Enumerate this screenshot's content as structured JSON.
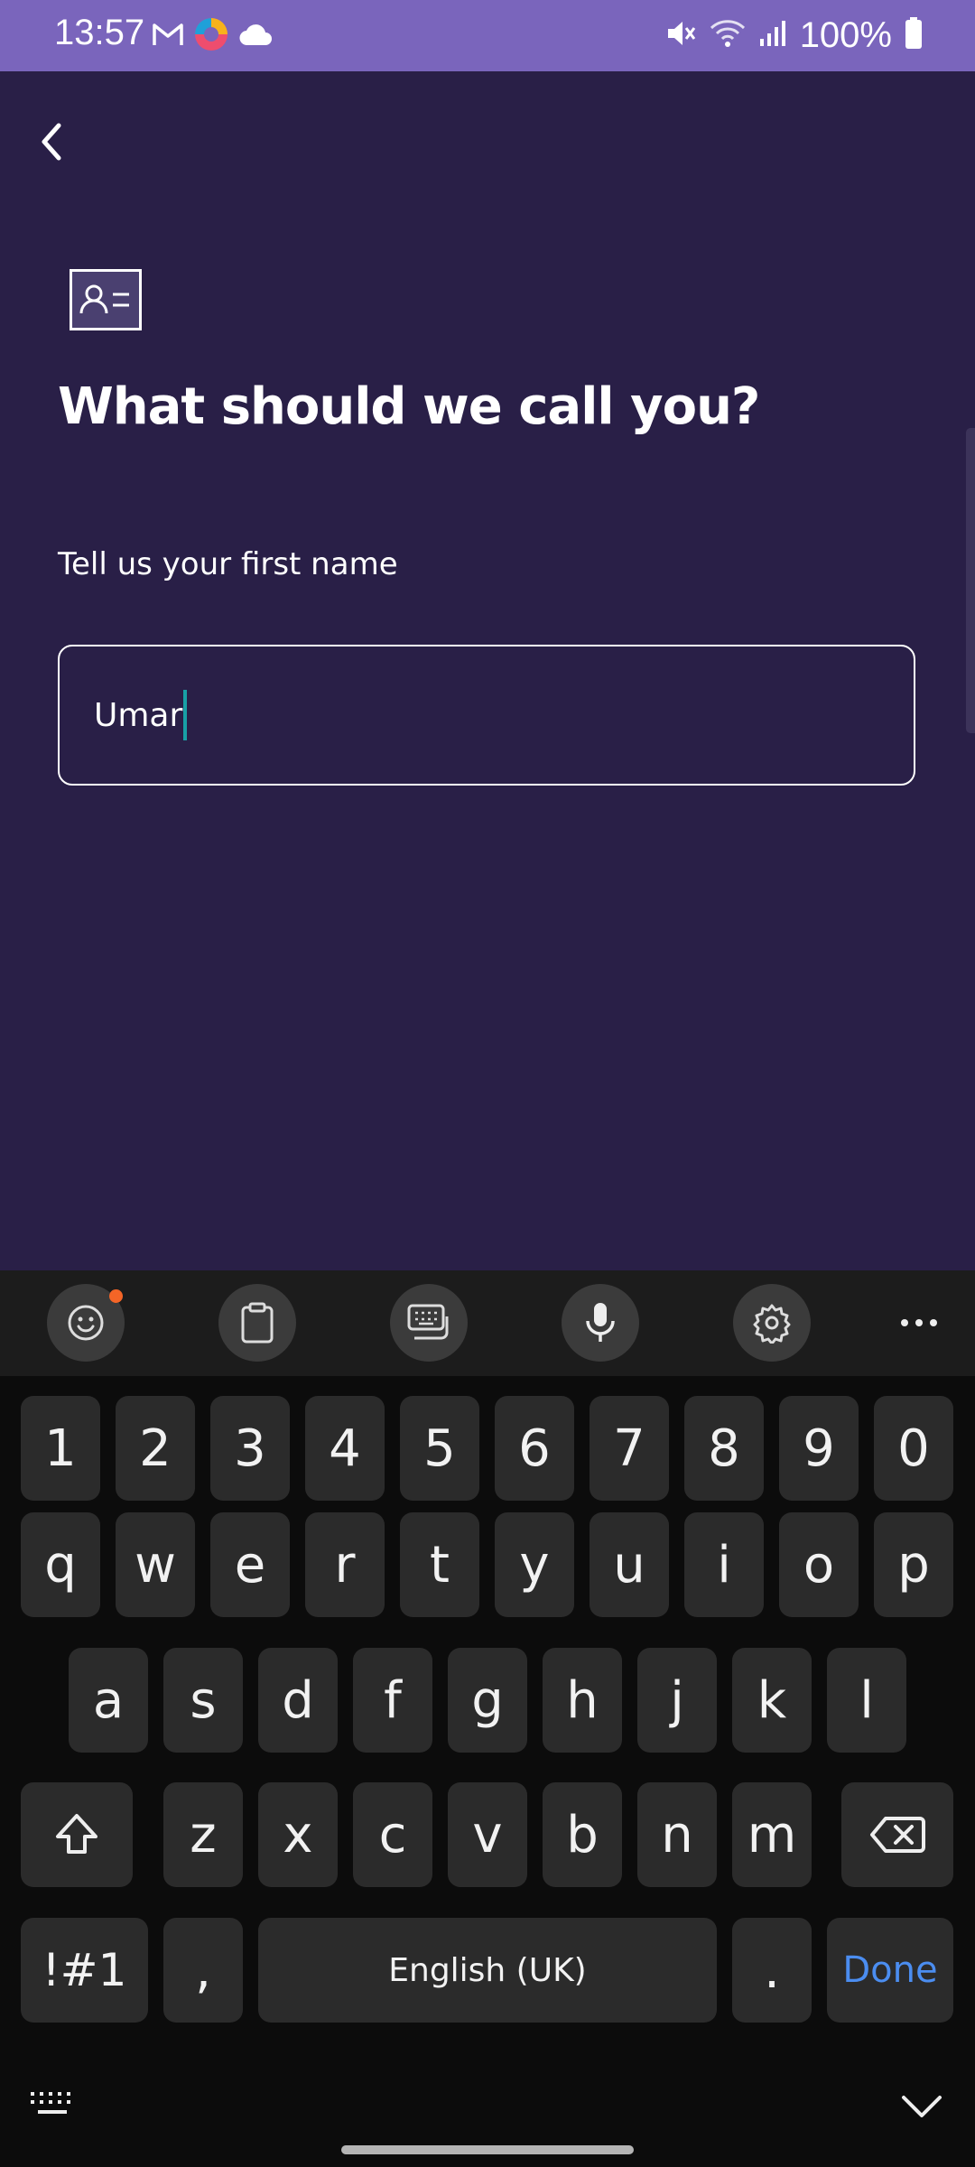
{
  "status_bar": {
    "time": "13:57",
    "battery": "100%",
    "icons_left": [
      "gmail-icon",
      "browser-icon",
      "cloud-icon"
    ],
    "icons_right": [
      "mute-icon",
      "wifi-icon",
      "signal-icon",
      "battery-icon"
    ]
  },
  "screen": {
    "title": "What should we call you?",
    "subtitle": "Tell us your first name",
    "name_input": {
      "value": "Umar"
    }
  },
  "keyboard": {
    "toolbar": [
      "emoji-icon",
      "clipboard-icon",
      "keyboard-mode-icon",
      "mic-icon",
      "settings-icon",
      "more-icon"
    ],
    "row_numbers": [
      "1",
      "2",
      "3",
      "4",
      "5",
      "6",
      "7",
      "8",
      "9",
      "0"
    ],
    "row1": [
      "q",
      "w",
      "e",
      "r",
      "t",
      "y",
      "u",
      "i",
      "o",
      "p"
    ],
    "row2": [
      "a",
      "s",
      "d",
      "f",
      "g",
      "h",
      "j",
      "k",
      "l"
    ],
    "row3": [
      "z",
      "x",
      "c",
      "v",
      "b",
      "n",
      "m"
    ],
    "symbols_label": "!#1",
    "comma_label": ",",
    "space_label": "English (UK)",
    "period_label": ".",
    "done_label": "Done"
  },
  "colors": {
    "status_bar": "#7a65bc",
    "background": "#291f47",
    "caret": "#18a0a6",
    "done": "#4b8df0",
    "notification_dot": "#f46527"
  }
}
